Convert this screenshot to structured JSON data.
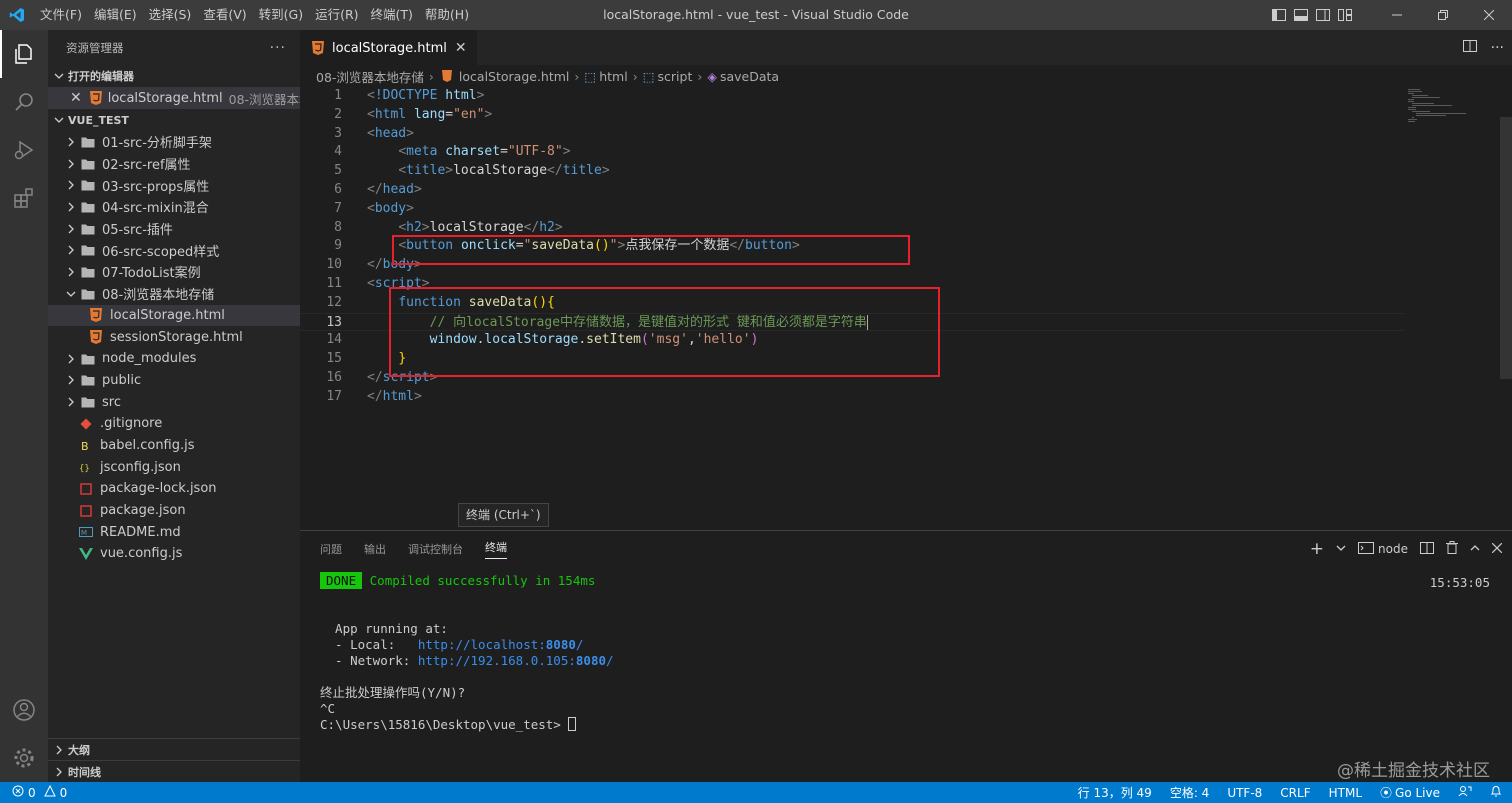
{
  "titlebar": {
    "menu": [
      "文件(F)",
      "编辑(E)",
      "选择(S)",
      "查看(V)",
      "转到(G)",
      "运行(R)",
      "终端(T)",
      "帮助(H)"
    ],
    "title": "localStorage.html - vue_test - Visual Studio Code"
  },
  "sidebar": {
    "title": "资源管理器",
    "open_editors_label": "打开的编辑器",
    "open_editor": {
      "name": "localStorage.html",
      "desc": "08-浏览器本地..."
    },
    "project_label": "VUE_TEST",
    "tree": [
      {
        "label": "01-src-分析脚手架",
        "type": "folder"
      },
      {
        "label": "02-src-ref属性",
        "type": "folder"
      },
      {
        "label": "03-src-props属性",
        "type": "folder"
      },
      {
        "label": "04-src-mixin混合",
        "type": "folder"
      },
      {
        "label": "05-src-插件",
        "type": "folder"
      },
      {
        "label": "06-src-scoped样式",
        "type": "folder"
      },
      {
        "label": "07-TodoList案例",
        "type": "folder"
      },
      {
        "label": "08-浏览器本地存储",
        "type": "folder-open"
      },
      {
        "label": "localStorage.html",
        "type": "html"
      },
      {
        "label": "sessionStorage.html",
        "type": "html"
      },
      {
        "label": "node_modules",
        "type": "folder"
      },
      {
        "label": "public",
        "type": "folder"
      },
      {
        "label": "src",
        "type": "folder"
      },
      {
        "label": ".gitignore",
        "type": "git"
      },
      {
        "label": "babel.config.js",
        "type": "babel"
      },
      {
        "label": "jsconfig.json",
        "type": "json"
      },
      {
        "label": "package-lock.json",
        "type": "npm"
      },
      {
        "label": "package.json",
        "type": "npm"
      },
      {
        "label": "README.md",
        "type": "md"
      },
      {
        "label": "vue.config.js",
        "type": "vue"
      }
    ],
    "outline_label": "大纲",
    "timeline_label": "时间线"
  },
  "editor": {
    "tab": "localStorage.html",
    "breadcrumb": [
      "08-浏览器本地存储",
      "localStorage.html",
      "html",
      "script",
      "saveData"
    ],
    "tooltip": "终端 (Ctrl+`)"
  },
  "panel": {
    "tabs": [
      "问题",
      "输出",
      "调试控制台",
      "终端"
    ],
    "shell": "node",
    "done": "DONE",
    "compiled": "Compiled successfully in 154ms",
    "time": "15:53:05",
    "app_running": "  App running at:",
    "local_label": "  - Local:   ",
    "local_url": "http://localhost:",
    "local_port": "8080",
    "network_label": "  - Network: ",
    "network_url": "http://192.168.0.105:",
    "network_port": "8080",
    "slash": "/",
    "prompt_q": "终止批处理操作吗(Y/N)?",
    "ctrl_c": "^C",
    "prompt": "C:\\Users\\15816\\Desktop\\vue_test>"
  },
  "statusbar": {
    "errors": "0",
    "warnings": "0",
    "position": "行 13，列 49",
    "spaces": "空格: 4",
    "encoding": "UTF-8",
    "eol": "CRLF",
    "language": "HTML",
    "golive": "Go Live"
  },
  "watermark": "@稀土掘金技术社区",
  "colors": {
    "accent": "#007acc",
    "highlight_box": "#e5212b"
  }
}
